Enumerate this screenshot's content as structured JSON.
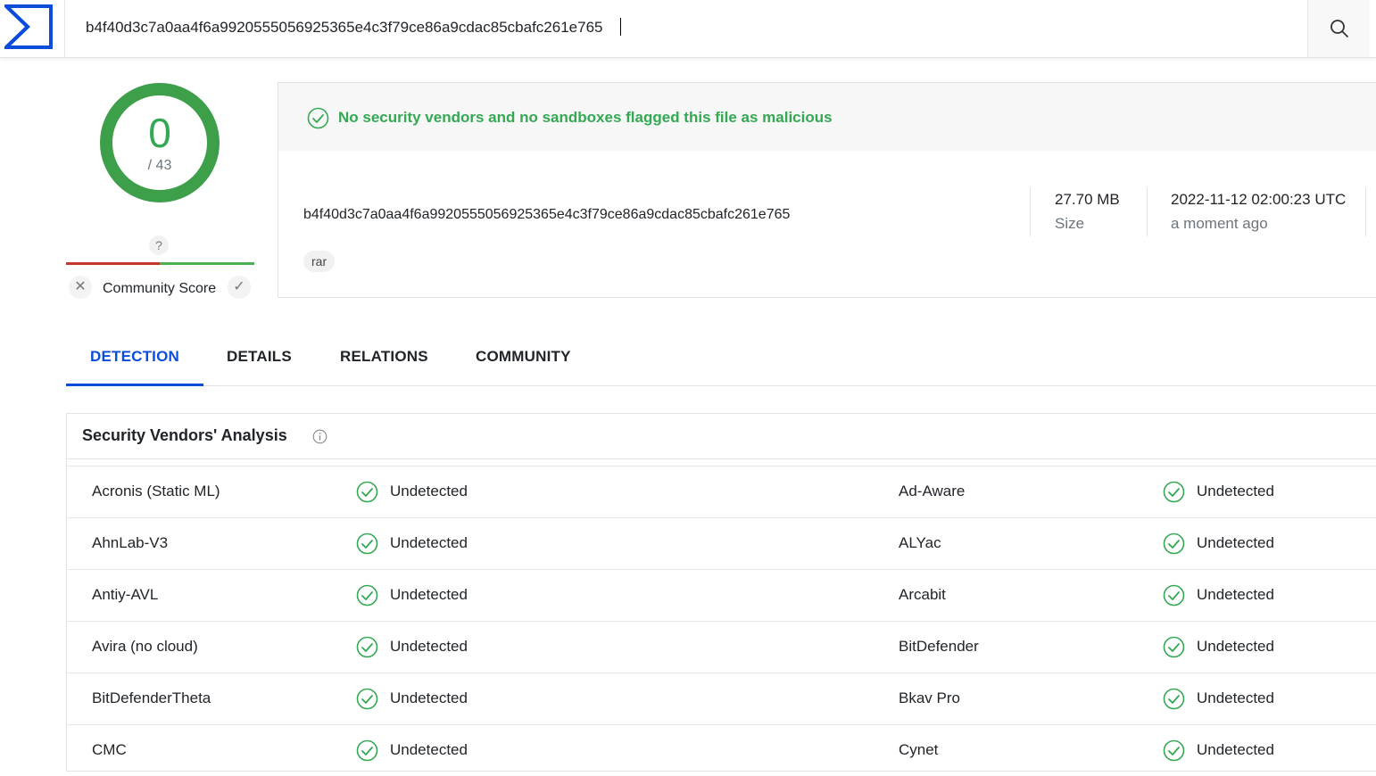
{
  "header": {
    "search_value": "b4f40d3c7a0aa4f6a9920555056925365e4c3f79ce86a9cdac85cbafc261e765"
  },
  "score": {
    "detections": "0",
    "total": "/ 43",
    "community_unknown": "?",
    "community_label": "Community Score"
  },
  "summary": {
    "verdict": "No security vendors and no sandboxes flagged this file as malicious",
    "hash": "b4f40d3c7a0aa4f6a9920555056925365e4c3f79ce86a9cdac85cbafc261e765",
    "tag": "rar",
    "size_value": "27.70 MB",
    "size_label": "Size",
    "date_value": "2022-11-12 02:00:23 UTC",
    "date_label": "a moment ago"
  },
  "tabs": [
    "DETECTION",
    "DETAILS",
    "RELATIONS",
    "COMMUNITY"
  ],
  "vendors": {
    "title": "Security Vendors' Analysis",
    "rows": [
      {
        "left_name": "Acronis (Static ML)",
        "left_result": "Undetected",
        "right_name": "Ad-Aware",
        "right_result": "Undetected"
      },
      {
        "left_name": "AhnLab-V3",
        "left_result": "Undetected",
        "right_name": "ALYac",
        "right_result": "Undetected"
      },
      {
        "left_name": "Antiy-AVL",
        "left_result": "Undetected",
        "right_name": "Arcabit",
        "right_result": "Undetected"
      },
      {
        "left_name": "Avira (no cloud)",
        "left_result": "Undetected",
        "right_name": "BitDefender",
        "right_result": "Undetected"
      },
      {
        "left_name": "BitDefenderTheta",
        "left_result": "Undetected",
        "right_name": "Bkav Pro",
        "right_result": "Undetected"
      },
      {
        "left_name": "CMC",
        "left_result": "Undetected",
        "right_name": "Cynet",
        "right_result": "Undetected"
      }
    ]
  },
  "colors": {
    "accent": "#0b4dda",
    "clean": "#34a853",
    "community_bad": "#c0392b",
    "community_good": "#4caf50"
  }
}
